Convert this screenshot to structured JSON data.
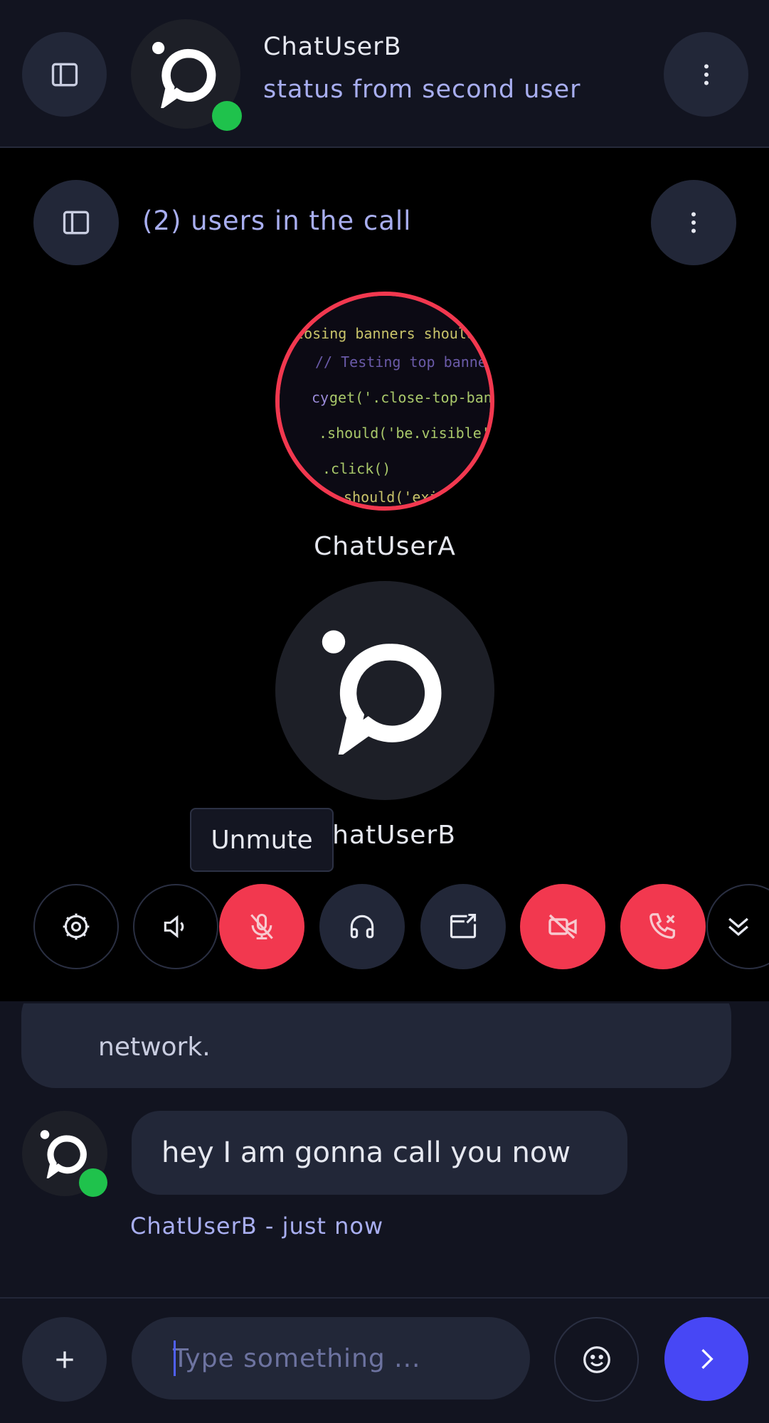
{
  "header": {
    "user_name": "ChatUserB",
    "status": "status from second user",
    "sidebar_icon": "sidebar-toggle-icon",
    "menu_icon": "more-vertical-icon"
  },
  "call": {
    "users_count_label": "(2) users in the call",
    "participants": [
      {
        "name": "ChatUserA",
        "avatar": "code-screenshot-avatar"
      },
      {
        "name": "ChatUserB",
        "avatar": "app-logo-avatar"
      }
    ],
    "tooltip": "Unmute",
    "controls": [
      {
        "name": "settings",
        "icon": "settings-icon"
      },
      {
        "name": "speaker",
        "icon": "speaker-icon"
      },
      {
        "name": "microphone",
        "icon": "mic-off-icon"
      },
      {
        "name": "headphones",
        "icon": "headphones-icon"
      },
      {
        "name": "share-screen",
        "icon": "share-screen-icon"
      },
      {
        "name": "video",
        "icon": "video-off-icon"
      },
      {
        "name": "hang-up",
        "icon": "phone-hangup-icon"
      },
      {
        "name": "collapse",
        "icon": "chevrons-down-icon"
      }
    ]
  },
  "chat": {
    "previous_message_tail": "network.",
    "message": {
      "text": "hey I am gonna call you now",
      "meta": "ChatUserB - just now"
    }
  },
  "composer": {
    "placeholder": "Type something ...",
    "add_icon": "plus-icon",
    "emoji_icon": "emoji-icon",
    "send_icon": "send-chevron-icon"
  },
  "colors": {
    "accent": "#4747f5",
    "danger": "#f2384f",
    "online": "#1fc24c",
    "link_text": "#a8aef0"
  }
}
